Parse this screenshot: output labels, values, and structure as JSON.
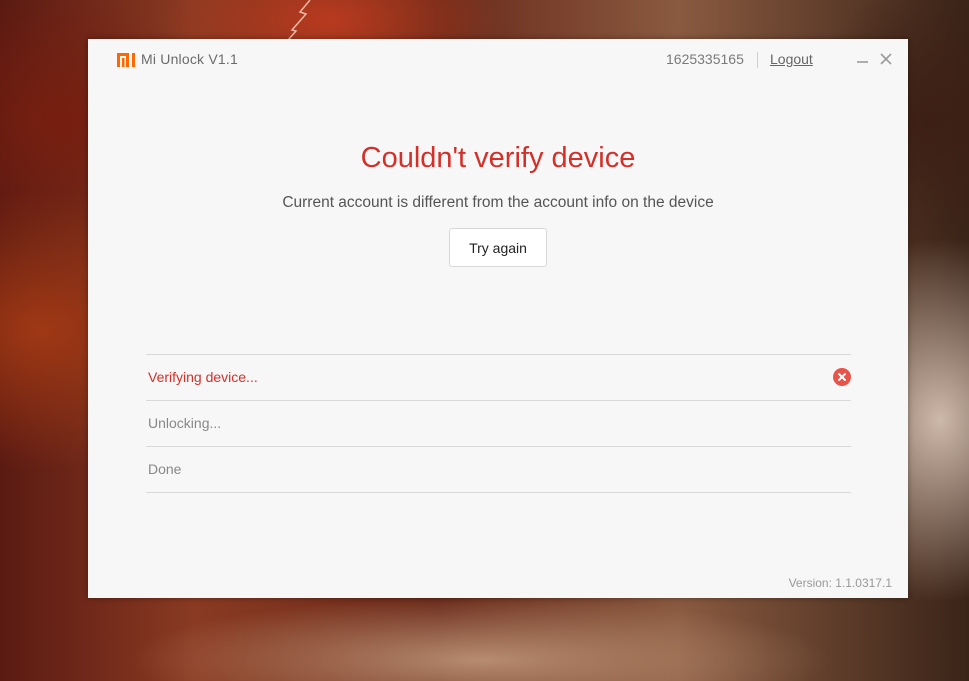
{
  "window": {
    "app_title": "Mi Unlock  V1.1",
    "account_id": "1625335165",
    "logout_label": "Logout",
    "version": "Version: 1.1.0317.1"
  },
  "status": {
    "title": "Couldn't verify device",
    "description": "Current account is different from the account info on the device",
    "retry_label": "Try again"
  },
  "steps": [
    {
      "label": "Verifying device...",
      "state": "failed"
    },
    {
      "label": "Unlocking...",
      "state": "pending"
    },
    {
      "label": "Done",
      "state": "pending"
    }
  ],
  "icons": {
    "logo": "mi-logo-icon",
    "minimize": "minimize-icon",
    "close": "close-icon",
    "step_failed": "error-circle-icon"
  },
  "colors": {
    "brand": "#ff6700",
    "error": "#d3302a",
    "fail_icon": "#e8544a"
  }
}
